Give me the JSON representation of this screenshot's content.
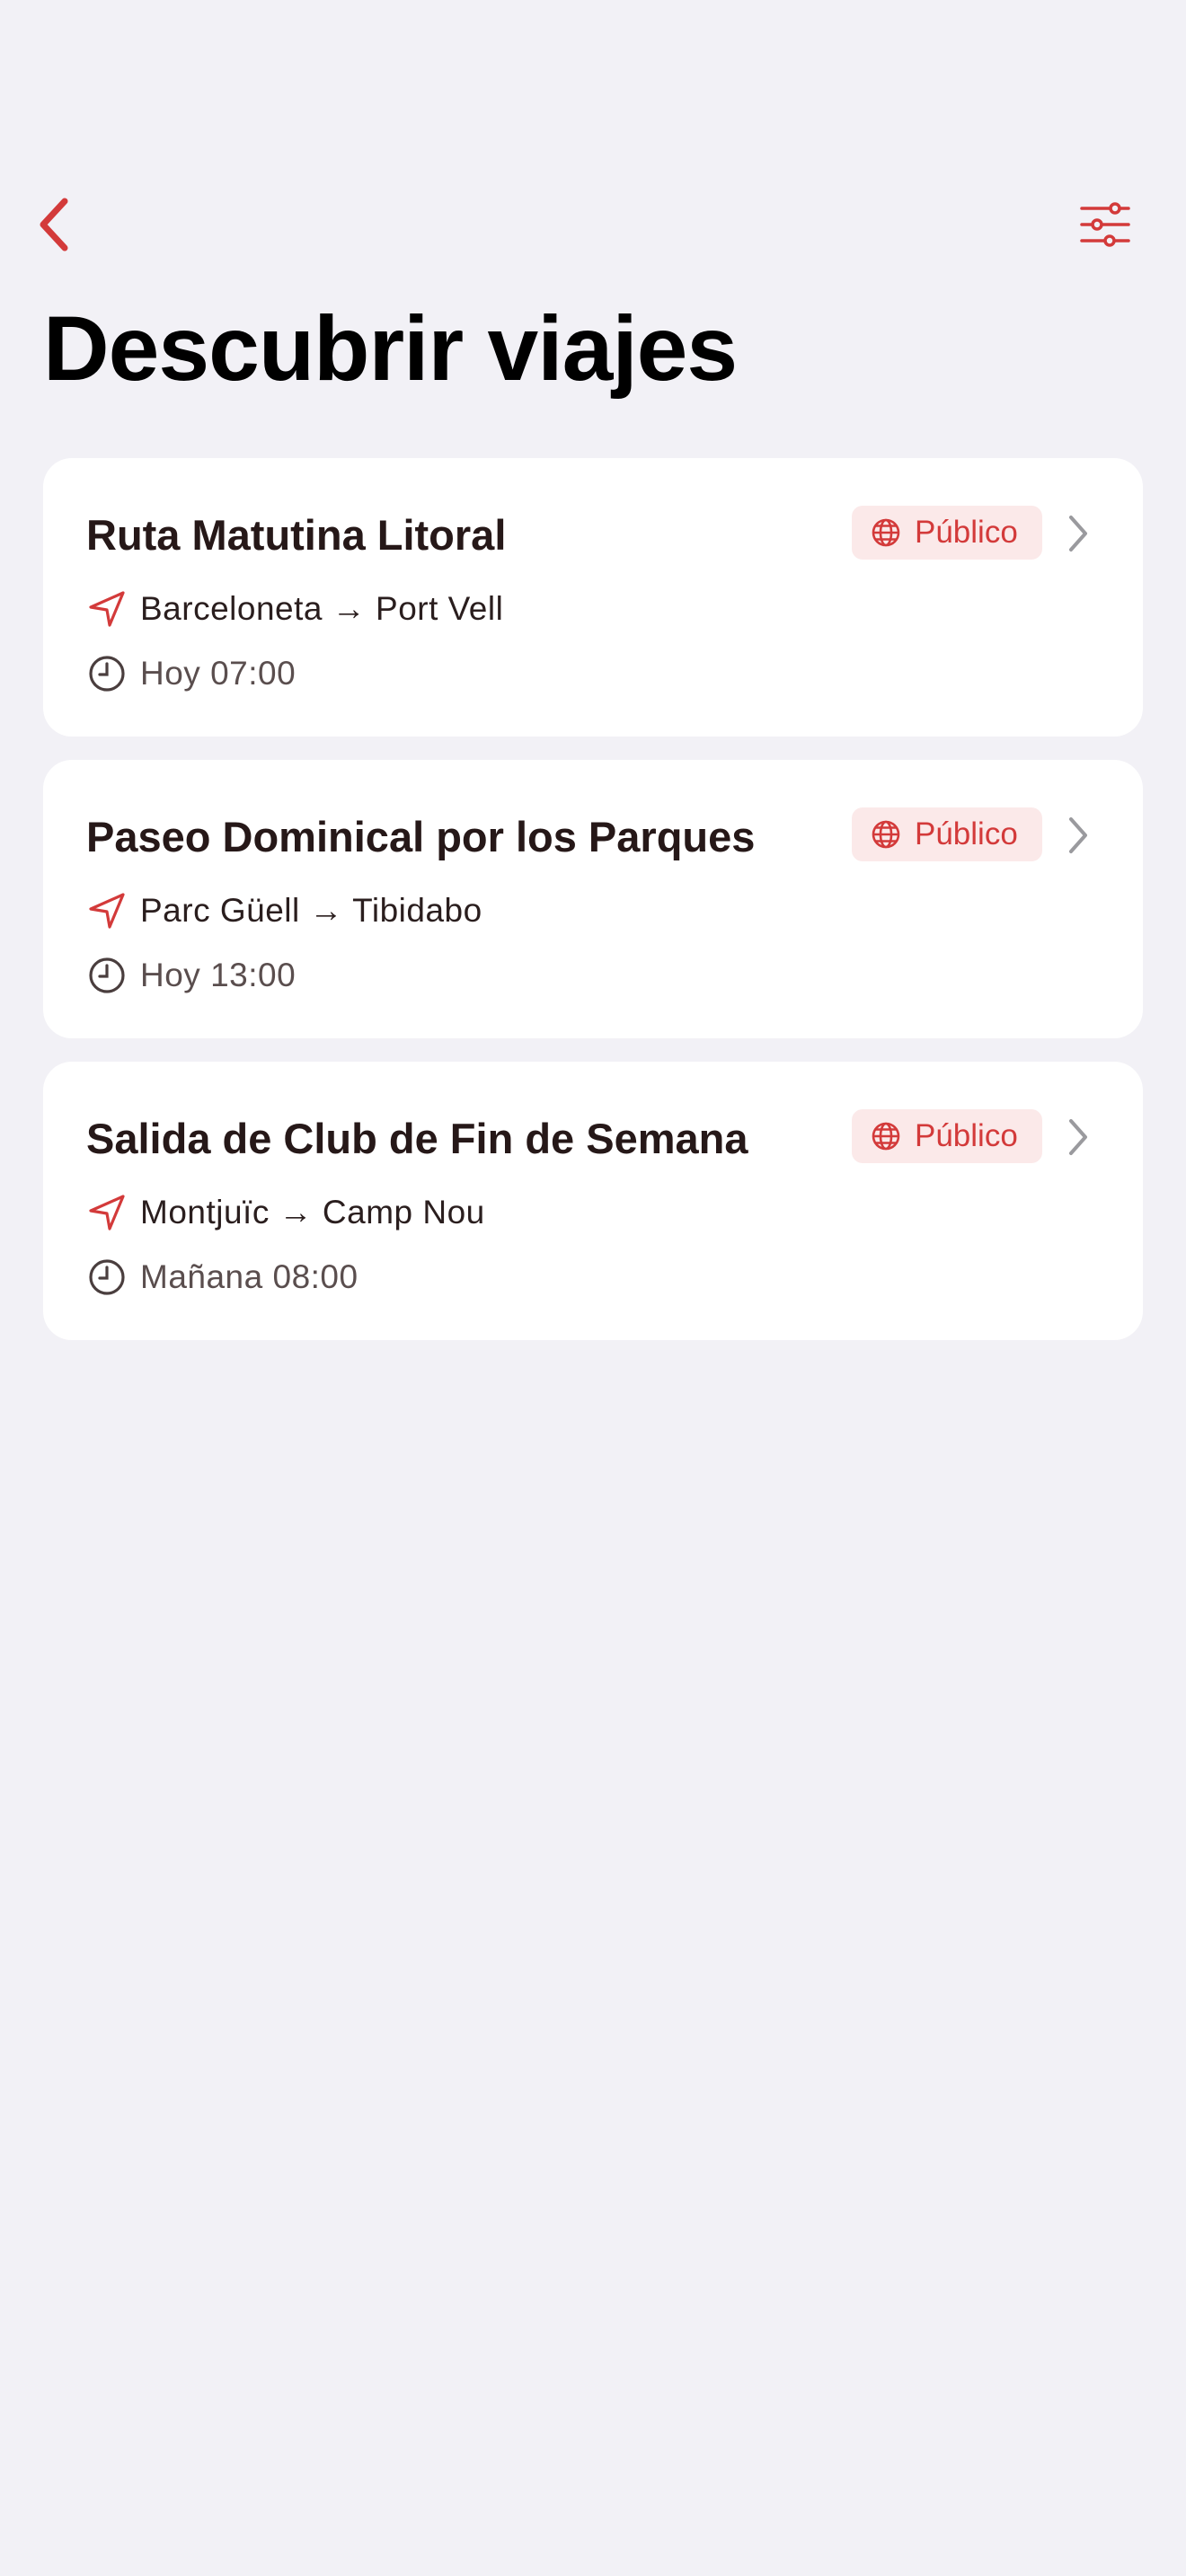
{
  "header": {
    "title": "Descubrir viajes"
  },
  "icons": {
    "back": "chevron-left-icon",
    "filter": "sliders-icon",
    "badge": "globe-icon",
    "route": "navigation-arrow-icon",
    "time": "clock-icon",
    "disclosure": "chevron-right-icon"
  },
  "colors": {
    "accent": "#D33A3A",
    "background": "#F2F1F6",
    "card": "#FFFFFF",
    "badge_bg": "#FBE9E9"
  },
  "trips": [
    {
      "title": "Ruta Matutina Litoral",
      "badge": "Público",
      "route": "Barceloneta → Port Vell",
      "time": "Hoy 07:00"
    },
    {
      "title": "Paseo Dominical por los Parques",
      "badge": "Público",
      "route": "Parc Güell → Tibidabo",
      "time": "Hoy 13:00"
    },
    {
      "title": "Salida de Club de Fin de Semana",
      "badge": "Público",
      "route": "Montjuïc → Camp Nou",
      "time": "Mañana 08:00"
    }
  ]
}
